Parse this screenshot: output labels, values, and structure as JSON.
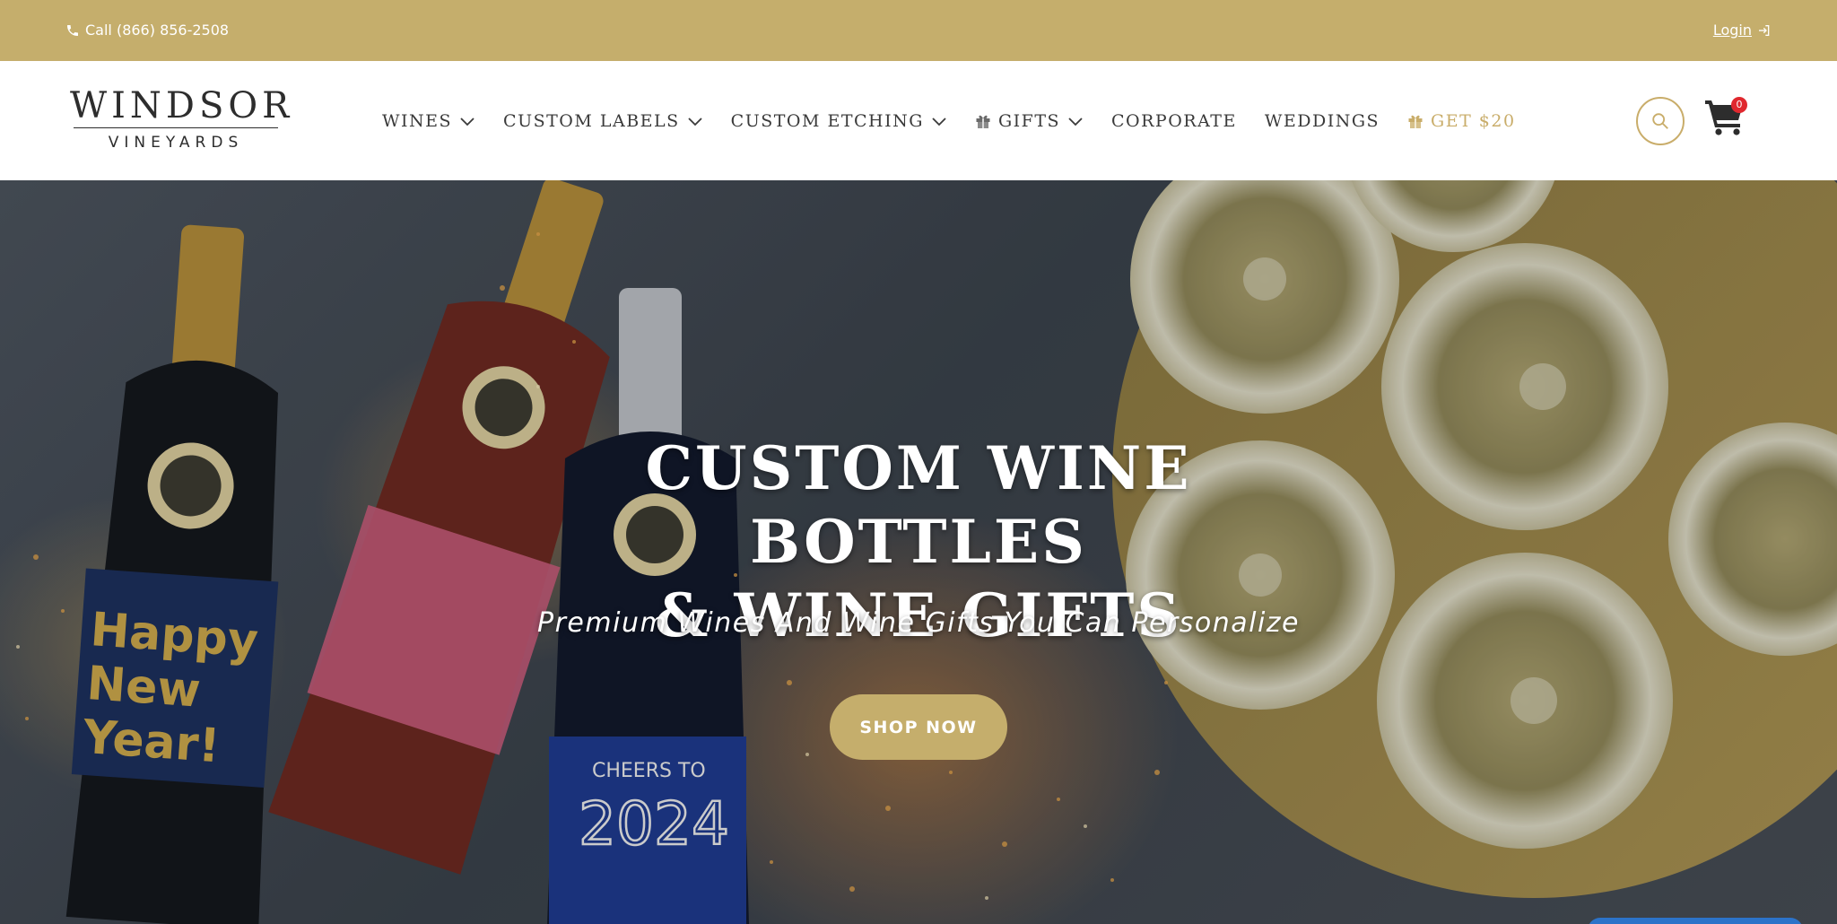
{
  "topbar": {
    "phone_label": "Call (866) 856-2508",
    "login_label": "Login",
    "phone_icon": "phone-icon",
    "login_icon": "login-arrow-icon"
  },
  "brand": {
    "line1": "WINDSOR",
    "line2": "VINEYARDS"
  },
  "nav": {
    "items": [
      {
        "label": "WINES",
        "has_dropdown": true
      },
      {
        "label": "CUSTOM LABELS",
        "has_dropdown": true
      },
      {
        "label": "CUSTOM ETCHING",
        "has_dropdown": true
      },
      {
        "label": "GIFTS",
        "has_dropdown": true,
        "icon": "gift-icon"
      },
      {
        "label": "CORPORATE",
        "has_dropdown": false
      },
      {
        "label": "WEDDINGS",
        "has_dropdown": false
      },
      {
        "label": "GET $20",
        "has_dropdown": false,
        "icon": "gift-icon"
      }
    ]
  },
  "actions": {
    "search_icon": "search-icon",
    "cart_icon": "cart-icon",
    "cart_count": "0"
  },
  "hero": {
    "title_line1": "CUSTOM WINE BOTTLES",
    "title_line2": "& WINE GIFTS",
    "subtitle": "Premium Wines And Wine Gifts You Can Personalize",
    "cta_label": "SHOP NOW"
  },
  "colors": {
    "gold": "#c5ae6c",
    "gold_text": "#c9ad6a",
    "nav_text": "#3a3a3a",
    "badge": "#e0282e"
  }
}
